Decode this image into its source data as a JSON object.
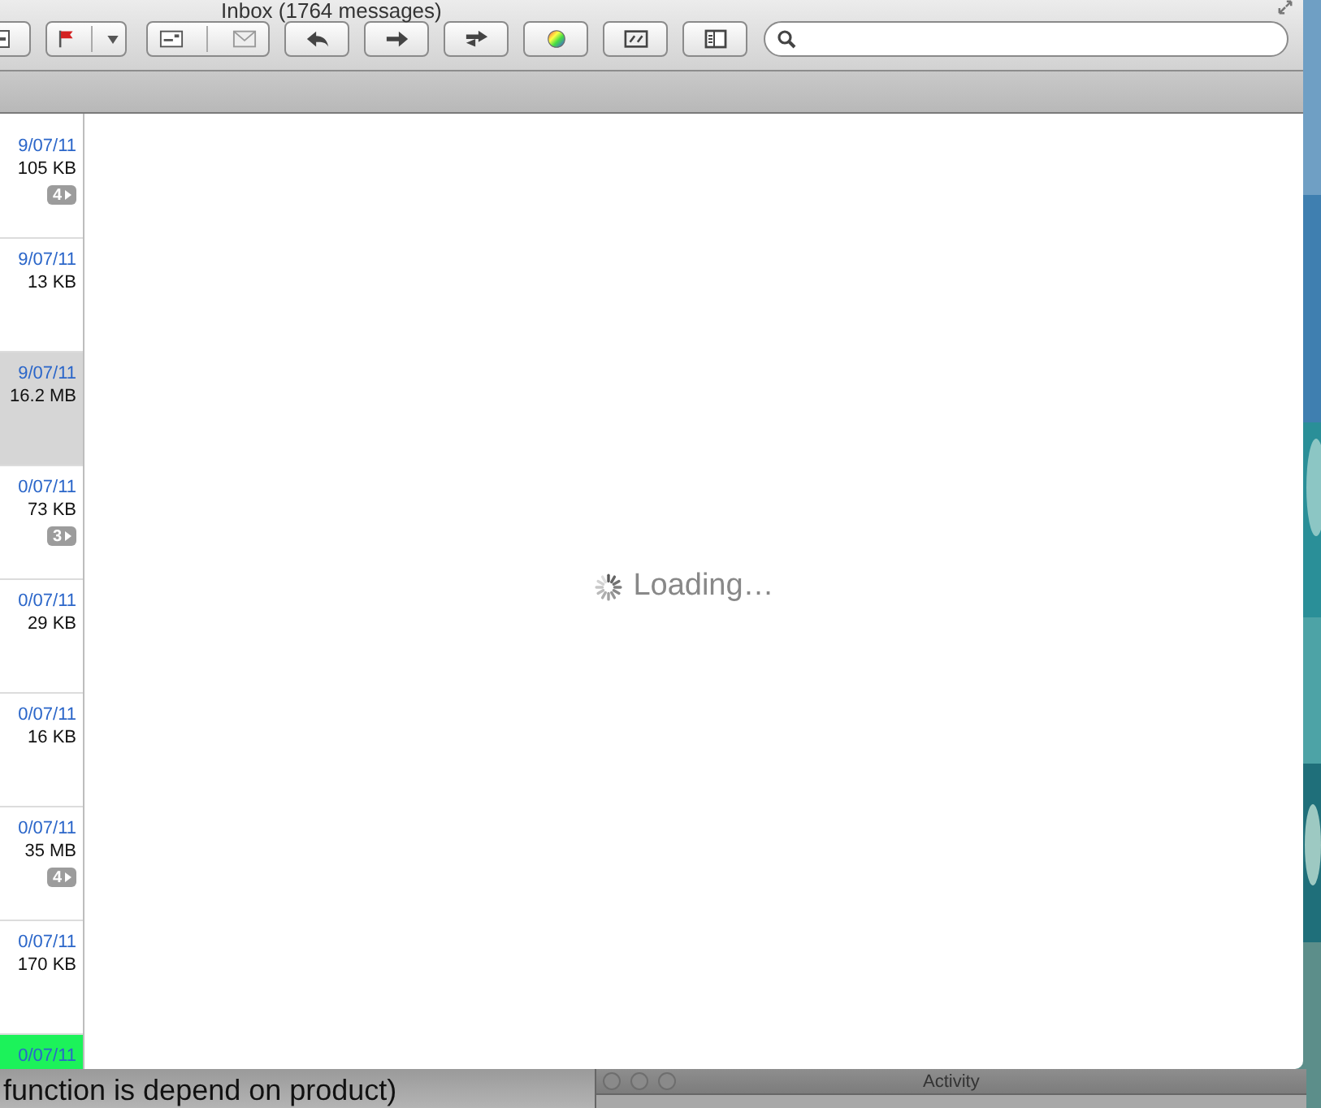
{
  "mail_window": {
    "title": "Inbox (1764 messages)",
    "messages": [
      {
        "date": "9/07/11",
        "size": "105 KB",
        "thread_count": "4",
        "selected": false,
        "highlighted": false
      },
      {
        "date": "9/07/11",
        "size": "13 KB",
        "selected": false,
        "highlighted": false
      },
      {
        "date": "9/07/11",
        "size": "16.2 MB",
        "selected": true,
        "highlighted": false
      },
      {
        "date": "0/07/11",
        "size": "73 KB",
        "thread_count": "3",
        "selected": false,
        "highlighted": false
      },
      {
        "date": "0/07/11",
        "size": "29 KB",
        "selected": false,
        "highlighted": false
      },
      {
        "date": "0/07/11",
        "size": "16 KB",
        "selected": false,
        "highlighted": false
      },
      {
        "date": "0/07/11",
        "size": "35 MB",
        "thread_count": "4",
        "selected": false,
        "highlighted": false
      },
      {
        "date": "0/07/11",
        "size": "170 KB",
        "selected": false,
        "highlighted": false
      },
      {
        "date": "0/07/11",
        "selected": false,
        "highlighted": true
      }
    ],
    "preview": {
      "status": "Loading…"
    }
  },
  "background_document": {
    "text": "function is depend on product)"
  },
  "activity_window": {
    "title": "Activity"
  }
}
